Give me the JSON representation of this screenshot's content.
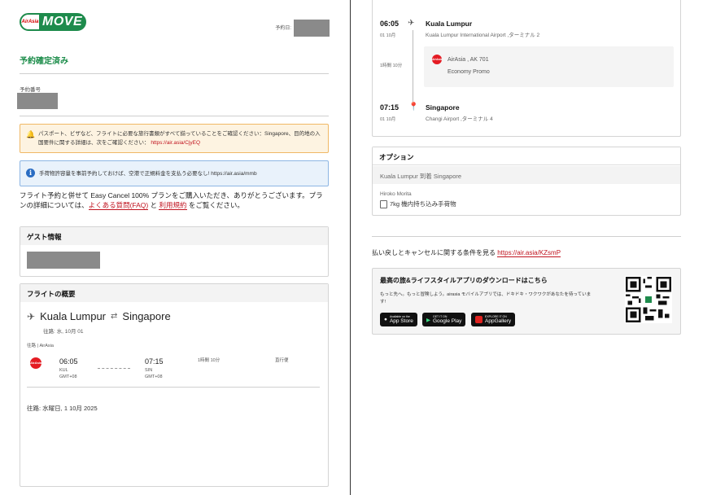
{
  "brand": {
    "logo_airline": "AirAsia",
    "logo_product": "MOVE"
  },
  "header": {
    "booking_date_label": "予約日:"
  },
  "left": {
    "confirmed": "予約確定済み",
    "booking_number_label": "予約番号",
    "warning": {
      "text": "パスポート、ビザなど、フライトに必要な旅行書類がすべて揃っていることをご確認ください：Singapore、目的地の入国要件に関する詳細は、次をご確認ください：",
      "link": "https://air.asia/CjyEQ"
    },
    "info": {
      "text": "手荷物許容量を事前予約しておけば、空港で正規料金を支払う必要なし! https://air.asia/mmb"
    },
    "para": {
      "before": "フライト予約と併せて Easy Cancel 100% プランをご購入いただき、ありがとうございます。プランの詳細については、",
      "faq_link": "よくある質問(FAQ)",
      "and": " と ",
      "terms_link": "利用規約",
      "after": " をご覧ください。"
    },
    "guest": {
      "title": "ゲスト情報"
    },
    "flight_summary": {
      "title": "フライトの概要",
      "from": "Kuala Lumpur",
      "to": "Singapore",
      "outbound_sub": "往路: 水, 10月 01",
      "airline_label": "往路 | AirAsia",
      "dep_time": "06:05",
      "dep_code": "KUL",
      "dep_tz": "GMT+08",
      "arr_time": "07:15",
      "arr_code": "SIN",
      "arr_tz": "GMT+08",
      "duration": "1時間 10分",
      "type": "直行便",
      "outbound_full": "往路: 水曜日, 1 10月 2025"
    }
  },
  "right": {
    "itinerary": {
      "dep_time": "06:05",
      "dep_date": "01 10月",
      "dep_city": "Kuala Lumpur",
      "dep_airport": "Kuala Lumpur International Airport ,ターミナル 2",
      "duration": "1時間 10分",
      "flight": "AirAsia , AK 701",
      "fare": "Economy Promo",
      "arr_time": "07:15",
      "arr_date": "01 10月",
      "arr_city": "Singapore",
      "arr_airport": "Changi Airport ,ターミナル 4"
    },
    "options": {
      "title": "オプション",
      "route": "Kuala Lumpur 到着 Singapore",
      "passenger": "Hiroko Morita",
      "item": "7kg 機内持ち込み手荷物"
    },
    "refund": {
      "text": "払い戻しとキャンセルに関する条件を見る",
      "link": "https://air.asia/KZsmP"
    },
    "app": {
      "title": "最高の旅&ライフスタイルアプリのダウンロードはこちら",
      "desc": "もっと先へ。もっと冒険しよう。airasia モバイルアプリでは、ドキドキ・ワクワクがあなたを待っています!",
      "appstore_small": "Available on the",
      "appstore": "App Store",
      "gplay_small": "GET IT ON",
      "gplay": "Google Play",
      "gallery_small": "EXPLORE IT ON",
      "gallery": "AppGallery"
    }
  }
}
